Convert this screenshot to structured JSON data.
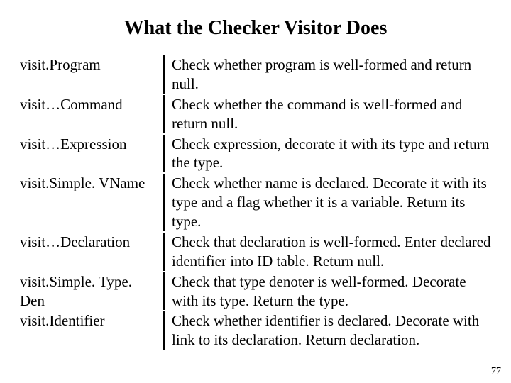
{
  "title": "What the Checker Visitor Does",
  "rows": [
    {
      "left": "visit.Program",
      "right": "Check whether program is well-formed and return null."
    },
    {
      "left": "visit…Command",
      "right": "Check whether the command is well-formed and return null."
    },
    {
      "left": "visit…Expression",
      "right": "Check expression, decorate it with its type and return the type."
    },
    {
      "left": "visit.Simple. VName",
      "right": "Check whether name is declared. Decorate it with its type and a flag whether it is a variable. Return its type."
    },
    {
      "left": "visit…Declaration",
      "right": "Check that declaration is well-formed. Enter declared identifier into ID table. Return null."
    },
    {
      "left": "visit.Simple. Type. Den",
      "right": "Check that type denoter is well-formed. Decorate with its type. Return the type."
    },
    {
      "left": "visit.Identifier",
      "right": "Check whether identifier is declared. Decorate with link to its declaration. Return declaration."
    }
  ],
  "page_number": "77"
}
